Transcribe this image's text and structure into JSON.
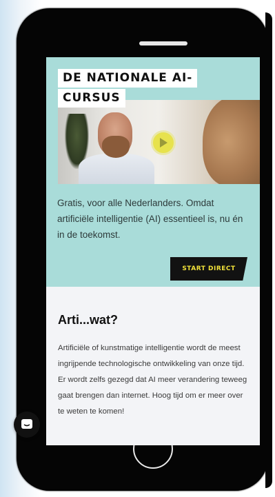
{
  "hero": {
    "title_line1": "DE NATIONALE AI-",
    "title_line2": "CURSUS",
    "intro": "Gratis, voor alle Nederlanders. Omdat artificiële intelligentie (AI) essentieel is, nu én in de toekomst.",
    "cta_label": "START DIRECT"
  },
  "article": {
    "heading": "Arti...wat?",
    "body": "Artificiële of kunstmatige intelligentie wordt de meest ingrijpende technologische ontwikkeling van onze tijd. Er wordt zelfs gezegd dat AI meer verandering teweeg gaat brengen dan internet. Hoog tijd om er meer over te weten te komen!"
  },
  "icons": {
    "play": "play-icon",
    "chat": "chat-icon"
  },
  "colors": {
    "hero_background": "#a9dcd9",
    "cta_background": "#121212",
    "cta_text": "#f2e23a",
    "play_button": "#e7e24d",
    "phone_body": "#050505"
  }
}
